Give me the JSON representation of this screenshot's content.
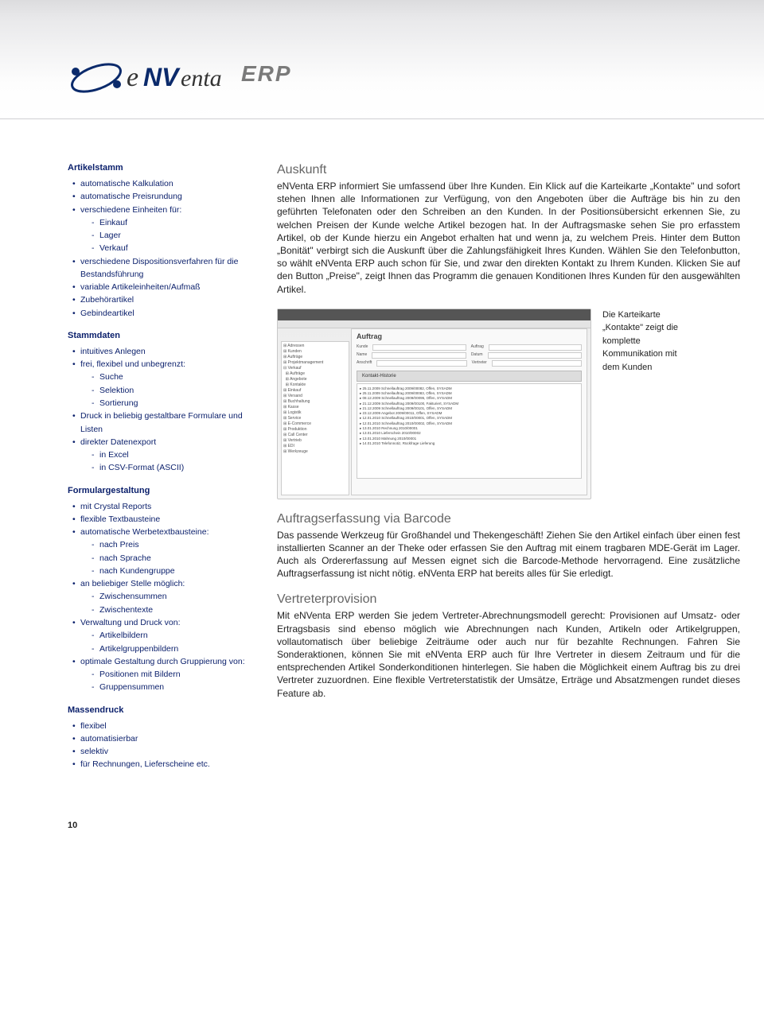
{
  "brand": {
    "name": "eNVenta",
    "suffix": "ERP"
  },
  "left": {
    "artikelstamm": {
      "title": "Artikelstamm",
      "items": [
        "automatische Kalkulation",
        "automatische Preisrundung",
        "verschiedene Einheiten für:",
        "verschiedene Dispositionsverfahren für die Bestandsführung",
        "variable Artikeleinheiten/Aufmaß",
        "Zubehörartikel",
        "Gebindeartikel"
      ],
      "einheiten_sub": [
        "Einkauf",
        "Lager",
        "Verkauf"
      ]
    },
    "stammdaten": {
      "title": "Stammdaten",
      "items": [
        "intuitives Anlegen",
        "frei, flexibel und unbegrenzt:",
        "Druck in beliebig gestaltbare Formulare und Listen",
        "direkter Datenexport"
      ],
      "flex_sub": [
        "Suche",
        "Selektion",
        "Sortierung"
      ],
      "export_sub": [
        "in Excel",
        "in CSV-Format (ASCII)"
      ]
    },
    "formulargestaltung": {
      "title": "Formulargestaltung",
      "items": [
        "mit Crystal Reports",
        "flexible Textbausteine",
        "automatische Werbetextbausteine:",
        "an beliebiger Stelle möglich:",
        "Verwaltung und Druck von:",
        "optimale Gestaltung durch Gruppierung von:"
      ],
      "werbe_sub": [
        "nach Preis",
        "nach Sprache",
        "nach Kundengruppe"
      ],
      "stelle_sub": [
        "Zwischensummen",
        "Zwischentexte"
      ],
      "druck_sub": [
        "Artikelbildern",
        "Artikelgruppenbildern"
      ],
      "gruppe_sub": [
        "Positionen mit Bildern",
        "Gruppensummen"
      ]
    },
    "massendruck": {
      "title": "Massendruck",
      "items": [
        "flexibel",
        "automatisierbar",
        "selektiv",
        "für Rechnungen, Lieferscheine etc."
      ]
    }
  },
  "main": {
    "auskunft": {
      "heading": "Auskunft",
      "body": "eNVenta ERP informiert Sie umfassend über Ihre Kunden. Ein Klick auf die Karteikarte „Kontakte\" und sofort stehen Ihnen alle Informationen zur Verfügung, von den Angeboten über die Aufträge bis hin zu den geführten Telefonaten oder den Schreiben an den Kunden. In der Positionsübersicht erkennen Sie, zu welchen Preisen der Kunde welche Artikel bezogen hat. In der Auftragsmaske sehen Sie pro erfasstem Artikel, ob der Kunde hierzu ein Angebot erhalten hat und wenn ja, zu welchem Preis. Hinter dem Button „Bonität\" verbirgt sich die Auskunft über die Zahlungsfähigkeit Ihres Kunden. Wählen Sie den Telefonbutton, so wählt eNVenta ERP auch schon für Sie, und zwar den direkten Kontakt zu Ihrem Kunden. Klicken Sie auf den Button „Preise\", zeigt Ihnen das Programm die genauen Konditionen Ihres Kunden für den ausgewählten Artikel."
    },
    "screenshot_caption": "Die Karteikarte „Kontakte\" zeigt die komplette Kommunikation mit dem Kunden",
    "screenshot_labels": {
      "window_title": "Auftrag",
      "history_tab": "Kontakt-Historie"
    },
    "barcode": {
      "heading": "Auftragserfassung via Barcode",
      "body": "Das passende Werkzeug für Großhandel und Thekengeschäft! Ziehen Sie den Artikel einfach über einen fest installierten Scanner an der Theke oder erfassen Sie den Auftrag mit einem tragbaren MDE-Gerät im Lager. Auch als Ordererfassung auf Messen eignet sich die Barcode-Methode hervorragend. Eine zusätzliche Auftragserfassung ist nicht nötig. eNVenta ERP hat bereits alles für Sie erledigt."
    },
    "vertreter": {
      "heading": "Vertreterprovision",
      "body": "Mit eNVenta ERP werden Sie jedem Vertreter-Abrechnungsmodell gerecht: Provisionen auf Umsatz- oder Ertragsbasis sind ebenso möglich wie Abrechnungen nach Kunden, Artikeln oder Artikelgruppen, vollautomatisch über beliebige Zeiträume oder auch nur für bezahlte Rechnungen. Fahren Sie Sonderaktionen, können Sie mit eNVenta ERP auch für Ihre Vertreter in diesem Zeitraum und für die entsprechenden Artikel Sonderkonditionen hinterlegen. Sie haben die Möglichkeit einem Auftrag bis zu drei Vertreter zuzuordnen. Eine flexible Vertreterstatistik der Umsätze, Erträge und Absatzmengen rundet dieses Feature ab."
    }
  },
  "page_number": "10"
}
